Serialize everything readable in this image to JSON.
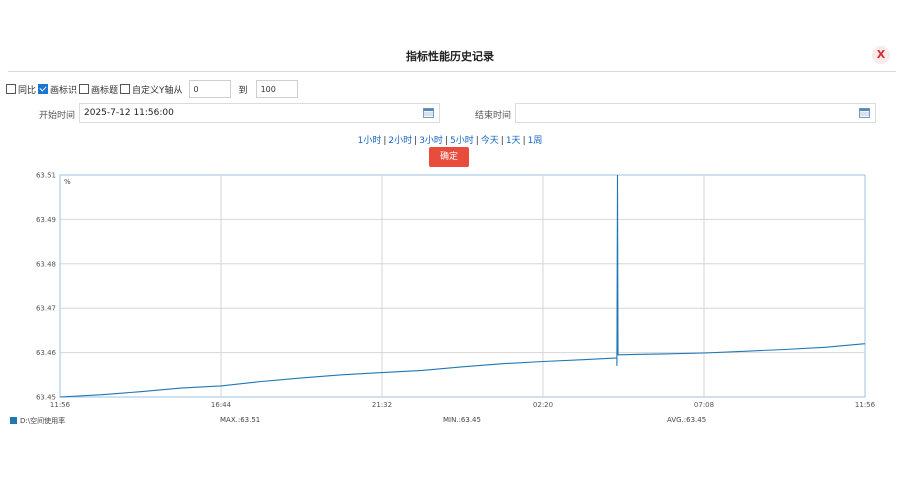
{
  "dialog": {
    "title": "指标性能历史记录",
    "close_label": "X"
  },
  "options": {
    "yoy_label": "同比",
    "yoy_checked": false,
    "draw_marks_label": "画标识",
    "draw_marks_checked": true,
    "draw_title_label": "画标题",
    "draw_title_checked": false,
    "custom_y_label": "自定义Y轴从",
    "custom_y_checked": false,
    "y_from": "0",
    "to_label": "到",
    "y_to": "100"
  },
  "time": {
    "start_label": "开始时间",
    "start_value": "2025-7-12 11:56:00",
    "end_label": "结束时间",
    "end_value": ""
  },
  "ranges": [
    "1小时",
    "2小时",
    "3小时",
    "5小时",
    "今天",
    "1天",
    "1周"
  ],
  "confirm_label": "确定",
  "chart_data": {
    "type": "line",
    "unit_label": "%",
    "x_ticks": [
      "11:56",
      "16:44",
      "21:32",
      "02:20",
      "07:08",
      "11:56"
    ],
    "y_ticks": [
      "63.45",
      "63.46",
      "63.47",
      "63.48",
      "63.49",
      "63.51"
    ],
    "ylim": [
      63.45,
      63.5
    ],
    "grid": true,
    "series": [
      {
        "name": "D:\\空间使用率",
        "color": "#1f77b4",
        "points": [
          [
            0,
            63.45
          ],
          [
            0.05,
            63.4505
          ],
          [
            0.1,
            63.4512
          ],
          [
            0.15,
            63.452
          ],
          [
            0.2,
            63.4525
          ],
          [
            0.25,
            63.4535
          ],
          [
            0.3,
            63.4543
          ],
          [
            0.35,
            63.455
          ],
          [
            0.4,
            63.4555
          ],
          [
            0.45,
            63.456
          ],
          [
            0.5,
            63.4568
          ],
          [
            0.55,
            63.4575
          ],
          [
            0.6,
            63.458
          ],
          [
            0.65,
            63.4584
          ],
          [
            0.68,
            63.4587
          ],
          [
            0.6918,
            63.4588
          ],
          [
            0.6918,
            63.457
          ],
          [
            0.6925,
            63.51
          ],
          [
            0.6932,
            63.4595
          ],
          [
            0.75,
            63.4597
          ],
          [
            0.8,
            63.4599
          ],
          [
            0.85,
            63.4603
          ],
          [
            0.9,
            63.4607
          ],
          [
            0.95,
            63.4612
          ],
          [
            1.0,
            63.462
          ]
        ]
      }
    ],
    "legend": {
      "series_name": "D:\\空间使用率",
      "max": "MAX.:63.51",
      "min": "MIN.:63.45",
      "avg": "AVG.:63.45"
    }
  }
}
